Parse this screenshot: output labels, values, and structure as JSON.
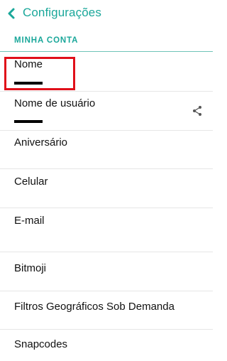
{
  "header": {
    "title": "Configurações",
    "back_icon": "chevron-left-icon",
    "accent_color": "#1aa79a"
  },
  "section": {
    "label": "MINHA CONTA"
  },
  "rows": [
    {
      "label": "Nome",
      "value_redacted": true,
      "highlighted": true
    },
    {
      "label": "Nome de usuário",
      "value_redacted": true,
      "trailing_icon": "share-icon"
    },
    {
      "label": "Aniversário"
    },
    {
      "label": "Celular"
    },
    {
      "label": "E-mail"
    },
    {
      "label": "Bitmoji"
    },
    {
      "label": "Filtros Geográficos Sob Demanda"
    },
    {
      "label": "Snapcodes"
    }
  ],
  "highlight_color": "#e0101a"
}
